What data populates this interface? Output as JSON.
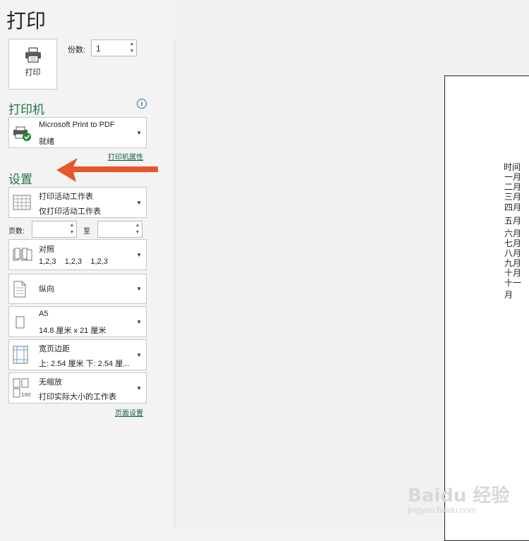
{
  "page": {
    "title": "打印"
  },
  "print_button": {
    "label": "打印",
    "icon": "printer-icon"
  },
  "copies": {
    "label": "份数:",
    "value": "1"
  },
  "printer": {
    "section_title": "打印机",
    "name": "Microsoft Print to PDF",
    "status": "就绪",
    "properties_link": "打印机属性",
    "info_icon": "info-icon"
  },
  "settings": {
    "section_title": "设置",
    "scope": {
      "title": "打印活动工作表",
      "subtitle": "仅打印活动工作表"
    },
    "pages": {
      "label": "页数:",
      "to_label": "至",
      "from_value": "",
      "to_value": ""
    },
    "collate": {
      "title": "对照",
      "subtitle": "1,2,3    1,2,3    1,2,3"
    },
    "orientation": {
      "title": "纵向"
    },
    "paper_size": {
      "title": "A5",
      "subtitle": "14.8 厘米 x 21 厘米"
    },
    "margins": {
      "title": "宽页边距",
      "subtitle": "上: 2.54 厘米 下: 2.54 厘..."
    },
    "scaling": {
      "title": "无缩放",
      "subtitle": "打印实际大小的工作表"
    },
    "page_setup_link": "页面设置"
  },
  "preview": {
    "column_header": "时间",
    "months": [
      "一月",
      "二月",
      "三月",
      "四月",
      "五月",
      "六月",
      "七月",
      "八月",
      "九月",
      "十月",
      "十一月"
    ]
  },
  "colors": {
    "accent": "#217346",
    "arrow": "#e8562a"
  },
  "watermark": {
    "logo": "Baidu 经验",
    "url": "jingyan.baidu.com"
  }
}
